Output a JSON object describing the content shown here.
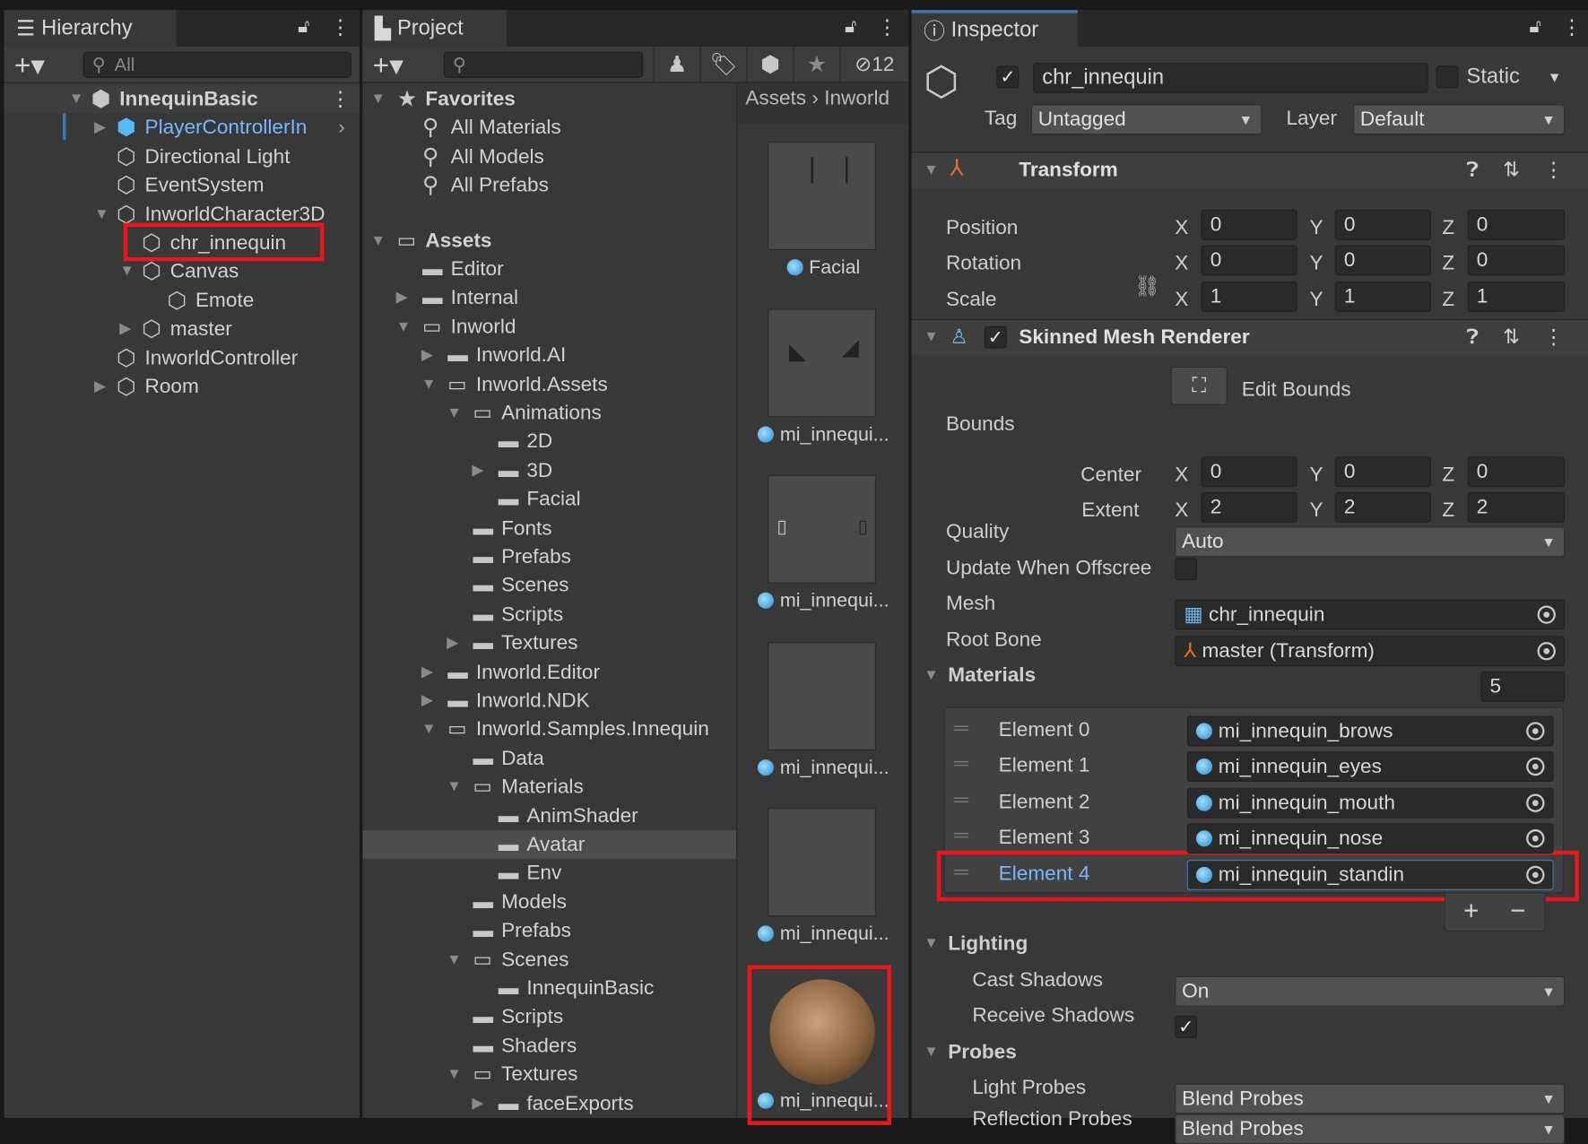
{
  "colors": {
    "selection_red": "#e8171c",
    "prefab_blue": "#79b8ff",
    "active_tab_accent": "#3a79bb",
    "panel_bg": "#383838"
  },
  "hierarchy": {
    "tab": "Hierarchy",
    "search_placeholder": "All",
    "items": [
      {
        "label": "InnequinBasic",
        "depth": 0,
        "arrow": "down",
        "icon": "scene",
        "bold": true
      },
      {
        "label": "PlayerControllerIn",
        "depth": 1,
        "arrow": "right",
        "icon": "prefab",
        "prefab": true
      },
      {
        "label": "Directional Light",
        "depth": 1,
        "arrow": "",
        "icon": "cube"
      },
      {
        "label": "EventSystem",
        "depth": 1,
        "arrow": "",
        "icon": "cube"
      },
      {
        "label": "InworldCharacter3D",
        "depth": 1,
        "arrow": "down",
        "icon": "cube"
      },
      {
        "label": "chr_innequin",
        "depth": 2,
        "arrow": "",
        "icon": "cube",
        "selected": true
      },
      {
        "label": "Canvas",
        "depth": 2,
        "arrow": "down",
        "icon": "cube"
      },
      {
        "label": "Emote",
        "depth": 3,
        "arrow": "",
        "icon": "cube"
      },
      {
        "label": "master",
        "depth": 2,
        "arrow": "right",
        "icon": "cube"
      },
      {
        "label": "InworldController",
        "depth": 1,
        "arrow": "",
        "icon": "cube"
      },
      {
        "label": "Room",
        "depth": 1,
        "arrow": "right",
        "icon": "cube"
      }
    ]
  },
  "project": {
    "tab": "Project",
    "hidden_count": "12",
    "breadcrumb": [
      "Assets",
      "Inworld"
    ],
    "tree": [
      {
        "label": "Favorites",
        "depth": 0,
        "arrow": "down",
        "icon": "star",
        "bold": true
      },
      {
        "label": "All Materials",
        "depth": 1,
        "arrow": "",
        "icon": "search"
      },
      {
        "label": "All Models",
        "depth": 1,
        "arrow": "",
        "icon": "search"
      },
      {
        "label": "All Prefabs",
        "depth": 1,
        "arrow": "",
        "icon": "search"
      },
      {
        "label": "",
        "depth": 0,
        "arrow": "",
        "icon": "",
        "gap": true
      },
      {
        "label": "Assets",
        "depth": 0,
        "arrow": "down",
        "icon": "folder-open",
        "bold": true
      },
      {
        "label": "Editor",
        "depth": 1,
        "arrow": "",
        "icon": "folder"
      },
      {
        "label": "Internal",
        "depth": 1,
        "arrow": "right",
        "icon": "folder"
      },
      {
        "label": "Inworld",
        "depth": 1,
        "arrow": "down",
        "icon": "folder-open"
      },
      {
        "label": "Inworld.AI",
        "depth": 2,
        "arrow": "right",
        "icon": "folder"
      },
      {
        "label": "Inworld.Assets",
        "depth": 2,
        "arrow": "down",
        "icon": "folder-open"
      },
      {
        "label": "Animations",
        "depth": 3,
        "arrow": "down",
        "icon": "folder-open"
      },
      {
        "label": "2D",
        "depth": 4,
        "arrow": "",
        "icon": "folder"
      },
      {
        "label": "3D",
        "depth": 4,
        "arrow": "right",
        "icon": "folder"
      },
      {
        "label": "Facial",
        "depth": 4,
        "arrow": "",
        "icon": "folder"
      },
      {
        "label": "Fonts",
        "depth": 3,
        "arrow": "",
        "icon": "folder"
      },
      {
        "label": "Prefabs",
        "depth": 3,
        "arrow": "",
        "icon": "folder"
      },
      {
        "label": "Scenes",
        "depth": 3,
        "arrow": "",
        "icon": "folder"
      },
      {
        "label": "Scripts",
        "depth": 3,
        "arrow": "",
        "icon": "folder"
      },
      {
        "label": "Textures",
        "depth": 3,
        "arrow": "right",
        "icon": "folder"
      },
      {
        "label": "Inworld.Editor",
        "depth": 2,
        "arrow": "right",
        "icon": "folder"
      },
      {
        "label": "Inworld.NDK",
        "depth": 2,
        "arrow": "right",
        "icon": "folder"
      },
      {
        "label": "Inworld.Samples.Innequin",
        "depth": 2,
        "arrow": "down",
        "icon": "folder-open"
      },
      {
        "label": "Data",
        "depth": 3,
        "arrow": "",
        "icon": "folder"
      },
      {
        "label": "Materials",
        "depth": 3,
        "arrow": "down",
        "icon": "folder-open"
      },
      {
        "label": "AnimShader",
        "depth": 4,
        "arrow": "",
        "icon": "folder"
      },
      {
        "label": "Avatar",
        "depth": 4,
        "arrow": "",
        "icon": "folder",
        "selected": true
      },
      {
        "label": "Env",
        "depth": 4,
        "arrow": "",
        "icon": "folder"
      },
      {
        "label": "Models",
        "depth": 3,
        "arrow": "",
        "icon": "folder"
      },
      {
        "label": "Prefabs",
        "depth": 3,
        "arrow": "",
        "icon": "folder"
      },
      {
        "label": "Scenes",
        "depth": 3,
        "arrow": "down",
        "icon": "folder-open"
      },
      {
        "label": "InnequinBasic",
        "depth": 4,
        "arrow": "",
        "icon": "folder"
      },
      {
        "label": "Scripts",
        "depth": 3,
        "arrow": "",
        "icon": "folder"
      },
      {
        "label": "Shaders",
        "depth": 3,
        "arrow": "",
        "icon": "folder"
      },
      {
        "label": "Textures",
        "depth": 3,
        "arrow": "down",
        "icon": "folder-open"
      },
      {
        "label": "faceExports",
        "depth": 4,
        "arrow": "right",
        "icon": "folder"
      }
    ],
    "assets": [
      {
        "label": "Facial",
        "kind": "brows"
      },
      {
        "label": "mi_innequi...",
        "kind": "eyes"
      },
      {
        "label": "mi_innequi...",
        "kind": "mouth"
      },
      {
        "label": "mi_innequi...",
        "kind": "plain"
      },
      {
        "label": "mi_innequi...",
        "kind": "plain"
      },
      {
        "label": "mi_innequi...",
        "kind": "sphere",
        "selected": true
      }
    ]
  },
  "inspector": {
    "tab": "Inspector",
    "object_name": "chr_innequin",
    "active": true,
    "static_label": "Static",
    "static": false,
    "tag_label": "Tag",
    "tag": "Untagged",
    "layer_label": "Layer",
    "layer": "Default",
    "transform": {
      "title": "Transform",
      "rows": [
        {
          "label": "Position",
          "x": "0",
          "y": "0",
          "z": "0"
        },
        {
          "label": "Rotation",
          "x": "0",
          "y": "0",
          "z": "0"
        },
        {
          "label": "Scale",
          "x": "1",
          "y": "1",
          "z": "1"
        }
      ]
    },
    "smr": {
      "title": "Skinned Mesh Renderer",
      "enabled": true,
      "edit_bounds": "Edit Bounds",
      "bounds_label": "Bounds",
      "center": {
        "label": "Center",
        "x": "0",
        "y": "0",
        "z": "0"
      },
      "extent": {
        "label": "Extent",
        "x": "2",
        "y": "2",
        "z": "2"
      },
      "quality_label": "Quality",
      "quality": "Auto",
      "offscreen_label": "Update When Offscree",
      "offscreen": false,
      "mesh_label": "Mesh",
      "mesh": "chr_innequin",
      "rootbone_label": "Root Bone",
      "rootbone": "master (Transform)",
      "materials_label": "Materials",
      "materials_count": "5",
      "materials": [
        {
          "label": "Element 0",
          "value": "mi_innequin_brows"
        },
        {
          "label": "Element 1",
          "value": "mi_innequin_eyes"
        },
        {
          "label": "Element 2",
          "value": "mi_innequin_mouth"
        },
        {
          "label": "Element 3",
          "value": "mi_innequin_nose"
        },
        {
          "label": "Element 4",
          "value": "mi_innequin_standin",
          "selected": true
        }
      ],
      "lighting_label": "Lighting",
      "cast_label": "Cast Shadows",
      "cast": "On",
      "receive_label": "Receive Shadows",
      "receive": true,
      "probes_label": "Probes",
      "lightprobes_label": "Light Probes",
      "lightprobes": "Blend Probes",
      "reflection_label": "Reflection Probes",
      "reflection": "Blend Probes"
    }
  }
}
